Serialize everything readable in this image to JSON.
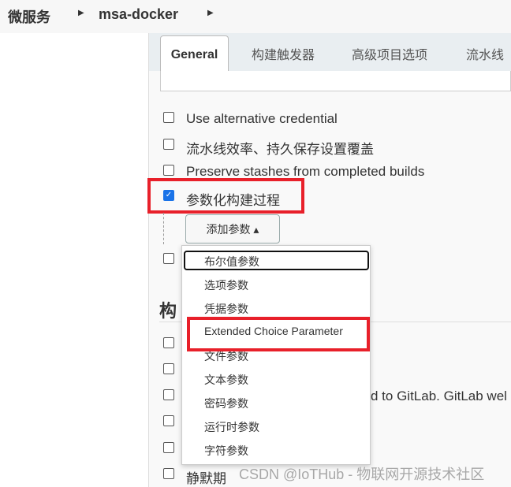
{
  "breadcrumb": {
    "items": [
      "微服务",
      "msa-docker"
    ]
  },
  "tabs": [
    "General",
    "构建触发器",
    "高级项目选项",
    "流水线"
  ],
  "options": [
    {
      "label": "Use alternative credential",
      "checked": false
    },
    {
      "label": "流水线效率、持久保存设置覆盖",
      "checked": false
    },
    {
      "label": "Preserve stashes from completed builds",
      "checked": false
    },
    {
      "label": "参数化构建过程",
      "checked": true
    }
  ],
  "add_param_button": "添加参数 ▴",
  "section_heading": "构",
  "gitlab_text": "d to GitLab. GitLab wel",
  "quiet_period": "静默期",
  "dropdown": [
    "布尔值参数",
    "选项参数",
    "凭据参数",
    "Extended Choice Parameter",
    "文件参数",
    "文本参数",
    "密码参数",
    "运行时参数",
    "字符参数"
  ],
  "watermark": "CSDN @IoTHub - 物联网开源技术社区",
  "colors": {
    "highlight": "#e8202a",
    "checkbox": "#1a73e8"
  }
}
